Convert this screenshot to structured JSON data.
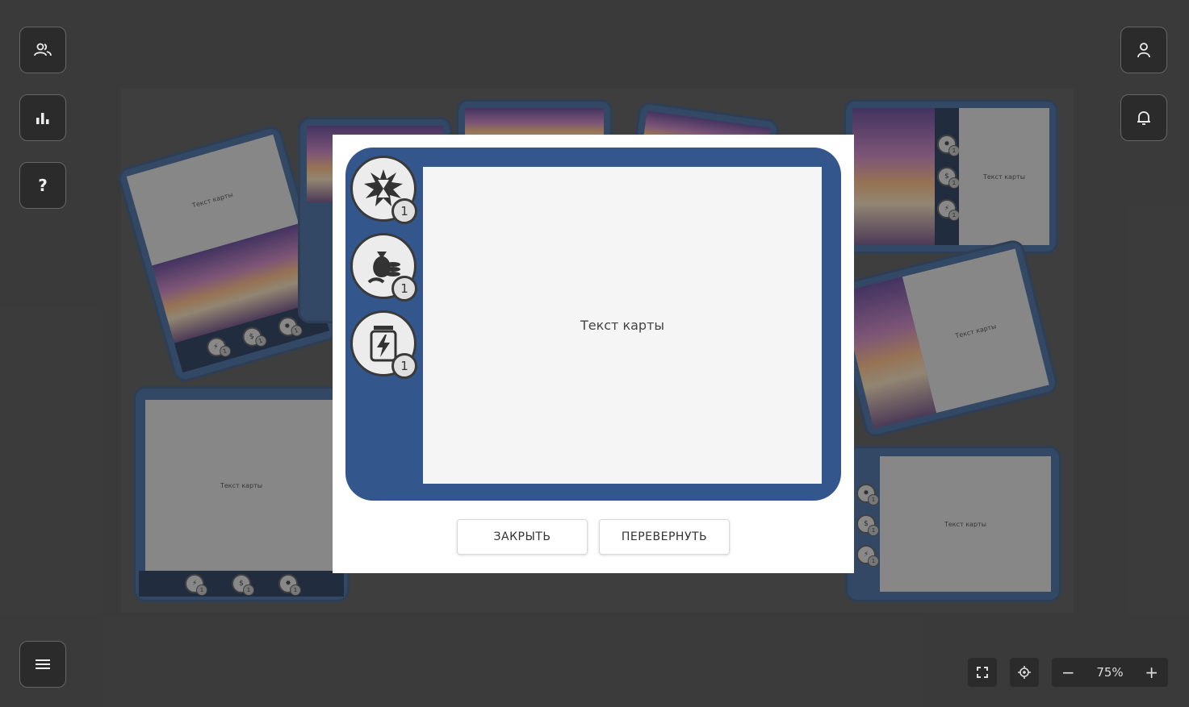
{
  "board": {
    "card_text": "Текст карты"
  },
  "sidebar": {
    "players_icon": "users-icon",
    "stats_icon": "bar-chart-icon",
    "help_label": "?",
    "menu_icon": "hamburger-icon",
    "profile_icon": "user-icon",
    "notifications_icon": "bell-icon"
  },
  "controls": {
    "fullscreen_icon": "fullscreen-icon",
    "center_icon": "target-icon",
    "zoom_out": "−",
    "zoom_level": "75%",
    "zoom_in": "+"
  },
  "modal": {
    "card_text": "Текст карты",
    "resources": [
      {
        "icon": "explosion-hourglass-icon",
        "count": "1"
      },
      {
        "icon": "money-bag-coins-icon",
        "count": "1"
      },
      {
        "icon": "energy-jar-icon",
        "count": "1"
      }
    ],
    "close_label": "ЗАКРЫТЬ",
    "flip_label": "ПЕРЕВЕРНУТЬ"
  },
  "colors": {
    "card_blue": "#33578d",
    "card_dark": "#1d3050",
    "overlay": "#2b2b2b"
  }
}
